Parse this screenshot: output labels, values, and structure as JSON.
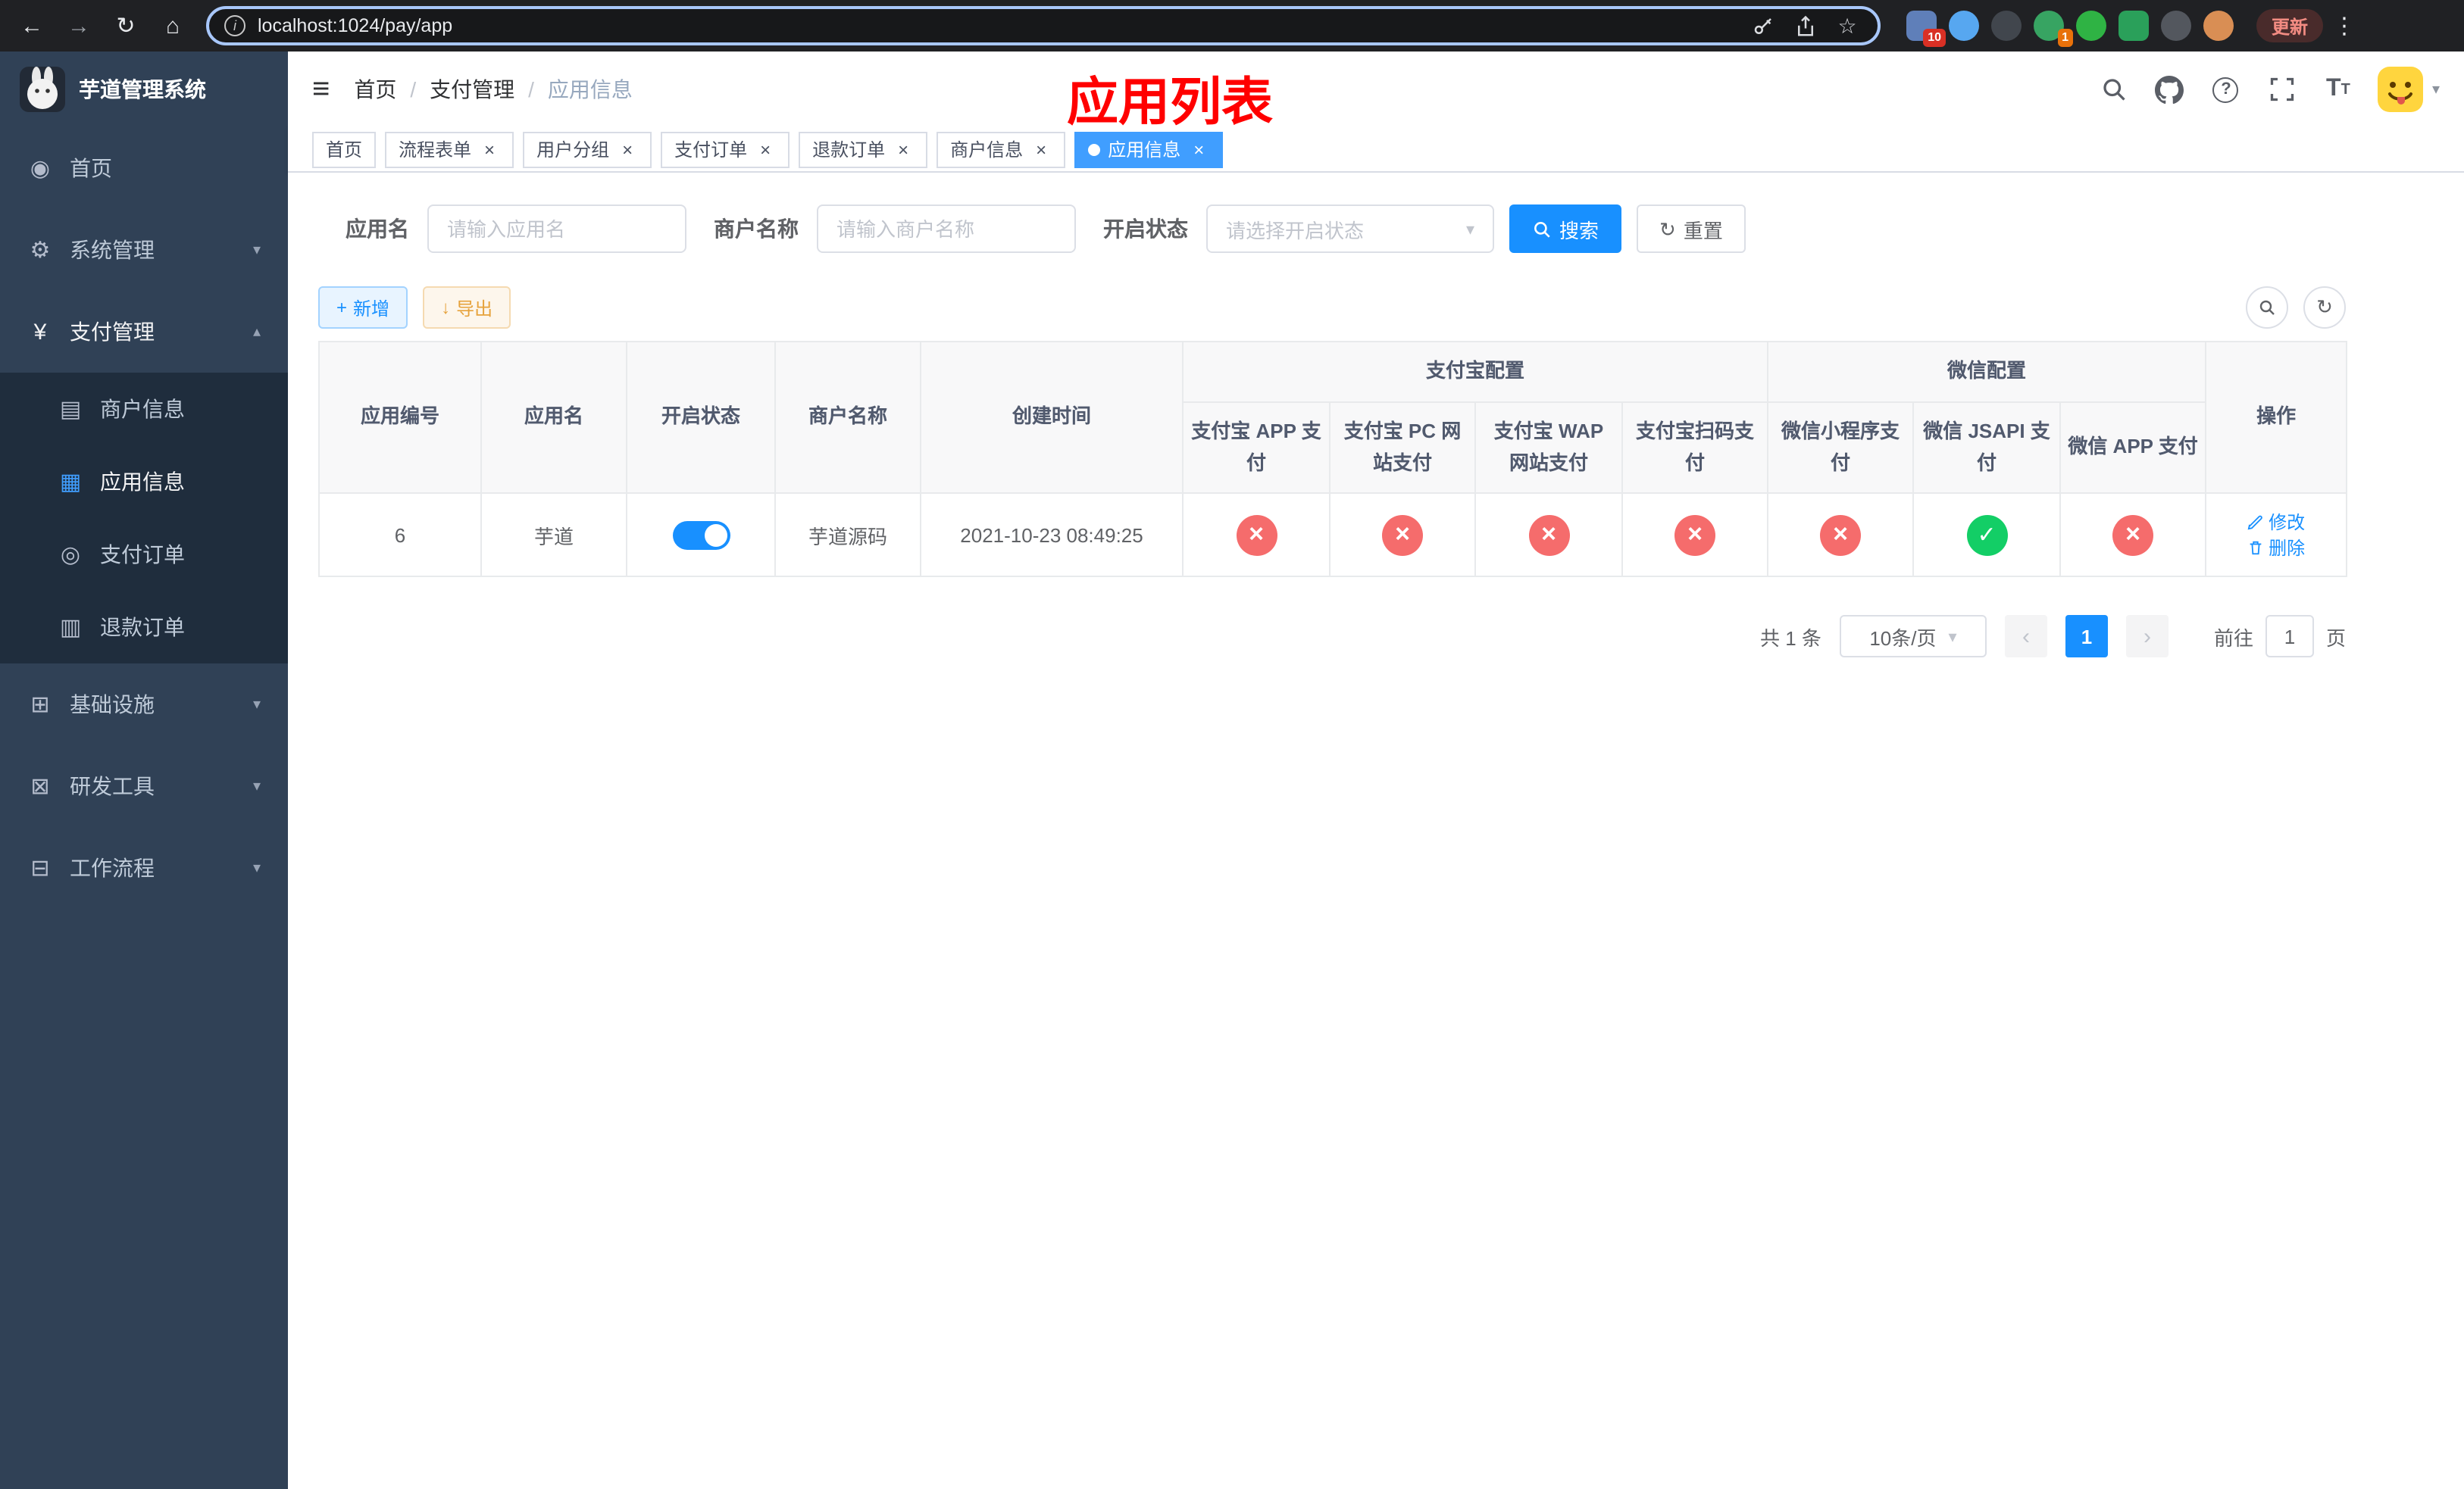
{
  "icons": {
    "back": "←",
    "forward": "→",
    "reload": "↻",
    "home": "⌂",
    "star": "☆",
    "dots_menu": "⋮",
    "hamburger": "≡",
    "menu_dashboard": "◉",
    "menu_system": "⚙",
    "menu_payment": "¥",
    "menu_merchant": "▤",
    "menu_app": "▦",
    "menu_order": "◎",
    "menu_refund": "▥",
    "menu_infra": "⊞",
    "menu_devtools": "⊠",
    "menu_workflow": "⊟",
    "chevron_down": "▾",
    "chevron_up": "▴",
    "close": "×",
    "slash": "/",
    "plus": "+",
    "download": "↓",
    "refresh": "↻",
    "caret_down": "▾",
    "prev": "‹",
    "next": "›",
    "font_size_big": "T",
    "font_size_small": "T"
  },
  "browser": {
    "url": "localhost:1024/pay/app",
    "update_label": "更新",
    "extension_badge": "10",
    "profile_badge": "1"
  },
  "sidebar": {
    "logo_title": "芋道管理系统",
    "menu": [
      {
        "label": "首页"
      },
      {
        "label": "系统管理"
      },
      {
        "label": "支付管理"
      },
      {
        "label": "基础设施"
      },
      {
        "label": "研发工具"
      },
      {
        "label": "工作流程"
      }
    ],
    "submenu": [
      {
        "label": "商户信息"
      },
      {
        "label": "应用信息"
      },
      {
        "label": "支付订单"
      },
      {
        "label": "退款订单"
      }
    ]
  },
  "header": {
    "breadcrumb": [
      {
        "label": "首页"
      },
      {
        "label": "支付管理"
      },
      {
        "label": "应用信息"
      }
    ],
    "annotation": "应用列表"
  },
  "tabs": [
    {
      "label": "首页"
    },
    {
      "label": "流程表单"
    },
    {
      "label": "用户分组"
    },
    {
      "label": "支付订单"
    },
    {
      "label": "退款订单"
    },
    {
      "label": "商户信息"
    },
    {
      "label": "应用信息"
    }
  ],
  "filters": {
    "app_name_label": "应用名",
    "app_name_placeholder": "请输入应用名",
    "merchant_label": "商户名称",
    "merchant_placeholder": "请输入商户名称",
    "status_label": "开启状态",
    "status_placeholder": "请选择开启状态",
    "search_label": "搜索",
    "reset_label": "重置"
  },
  "toolbar": {
    "add_label": "新增",
    "export_label": "导出"
  },
  "table": {
    "columns": {
      "app_id": "应用编号",
      "app_name": "应用名",
      "status": "开启状态",
      "merchant": "商户名称",
      "created": "创建时间",
      "op": "操作"
    },
    "groups": {
      "alipay": {
        "title": "支付宝配置",
        "columns": [
          "支付宝 APP 支付",
          "支付宝 PC 网站支付",
          "支付宝 WAP 网站支付",
          "支付宝扫码支付"
        ]
      },
      "wechat": {
        "title": "微信配置",
        "columns": [
          "微信小程序支付",
          "微信 JSAPI 支付",
          "微信 APP 支付"
        ]
      }
    },
    "rows": [
      {
        "app_id": "6",
        "app_name": "芋道",
        "enabled": true,
        "merchant": "芋道源码",
        "created": "2021-10-23 08:49:25",
        "channels": [
          "x",
          "x",
          "x",
          "x",
          "x",
          "check",
          "x"
        ],
        "edit_label": "修改",
        "delete_label": "删除"
      }
    ]
  },
  "pagination": {
    "total": "共 1 条",
    "page_size": "10条/页",
    "page": "1",
    "goto_label": "前往",
    "goto_value": "1",
    "unit_label": "页"
  },
  "colors": {
    "primary": "#1890ff",
    "active_tab": "#409eff",
    "danger": "#f56c6c",
    "success": "#13ce66",
    "warning": "#e6a23c",
    "sidebar_bg": "#304156",
    "submenu_bg": "#1f2d3d",
    "annotation_red": "#ff0000"
  }
}
